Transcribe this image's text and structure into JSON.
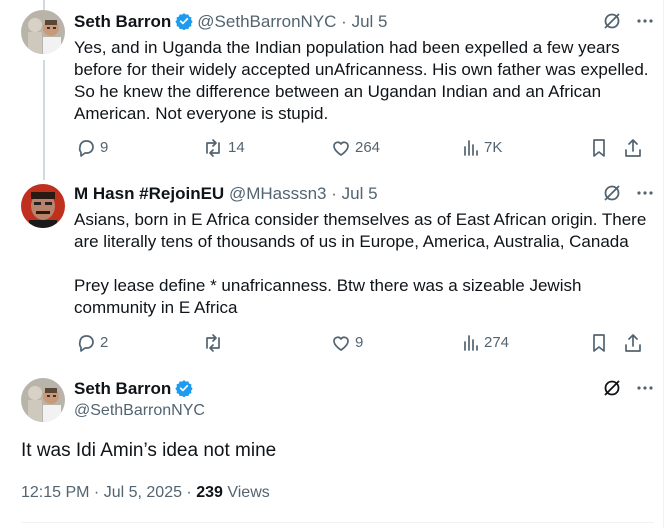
{
  "tweets": [
    {
      "name": "Seth Barron",
      "handle": "@SethBarronNYC",
      "date": "Jul 5",
      "body": [
        "Yes, and in Uganda the Indian population had been expelled a few years before for their widely accepted unAfricanness. His own father was expelled. So he knew the difference between an Ugandan Indian and an African American. Not everyone is stupid."
      ],
      "replies": "9",
      "reposts": "14",
      "likes": "264",
      "views": "7K"
    },
    {
      "name": "M Hasn #RejoinEU",
      "handle": "@MHasssn3",
      "date": "Jul 5",
      "body": [
        "Asians, born in E Africa consider themselves as of East African origin. There are literally tens of thousands of us in Europe, America, Australia, Canada",
        "Prey lease define * unafricanness. Btw there was a sizeable Jewish community in E Africa"
      ],
      "replies": "2",
      "reposts": "",
      "likes": "9",
      "views": "274"
    }
  ],
  "main_tweet": {
    "name": "Seth Barron",
    "handle": "@SethBarronNYC",
    "text": "It was Idi Amin’s idea not mine",
    "time": "12:15 PM · Jul 5, 2025",
    "views_count": "239",
    "views_label": "Views"
  },
  "icons": {
    "verified": "verified-badge-icon",
    "grok": "grok-icon",
    "more": "more-icon",
    "reply": "reply-icon",
    "repost": "repost-icon",
    "like": "like-icon",
    "views": "views-icon",
    "bookmark": "bookmark-icon",
    "share": "share-icon"
  },
  "colors": {
    "verified": "#1d9bf0",
    "secondary_text": "#536471",
    "thread_line": "#cfd9de"
  }
}
